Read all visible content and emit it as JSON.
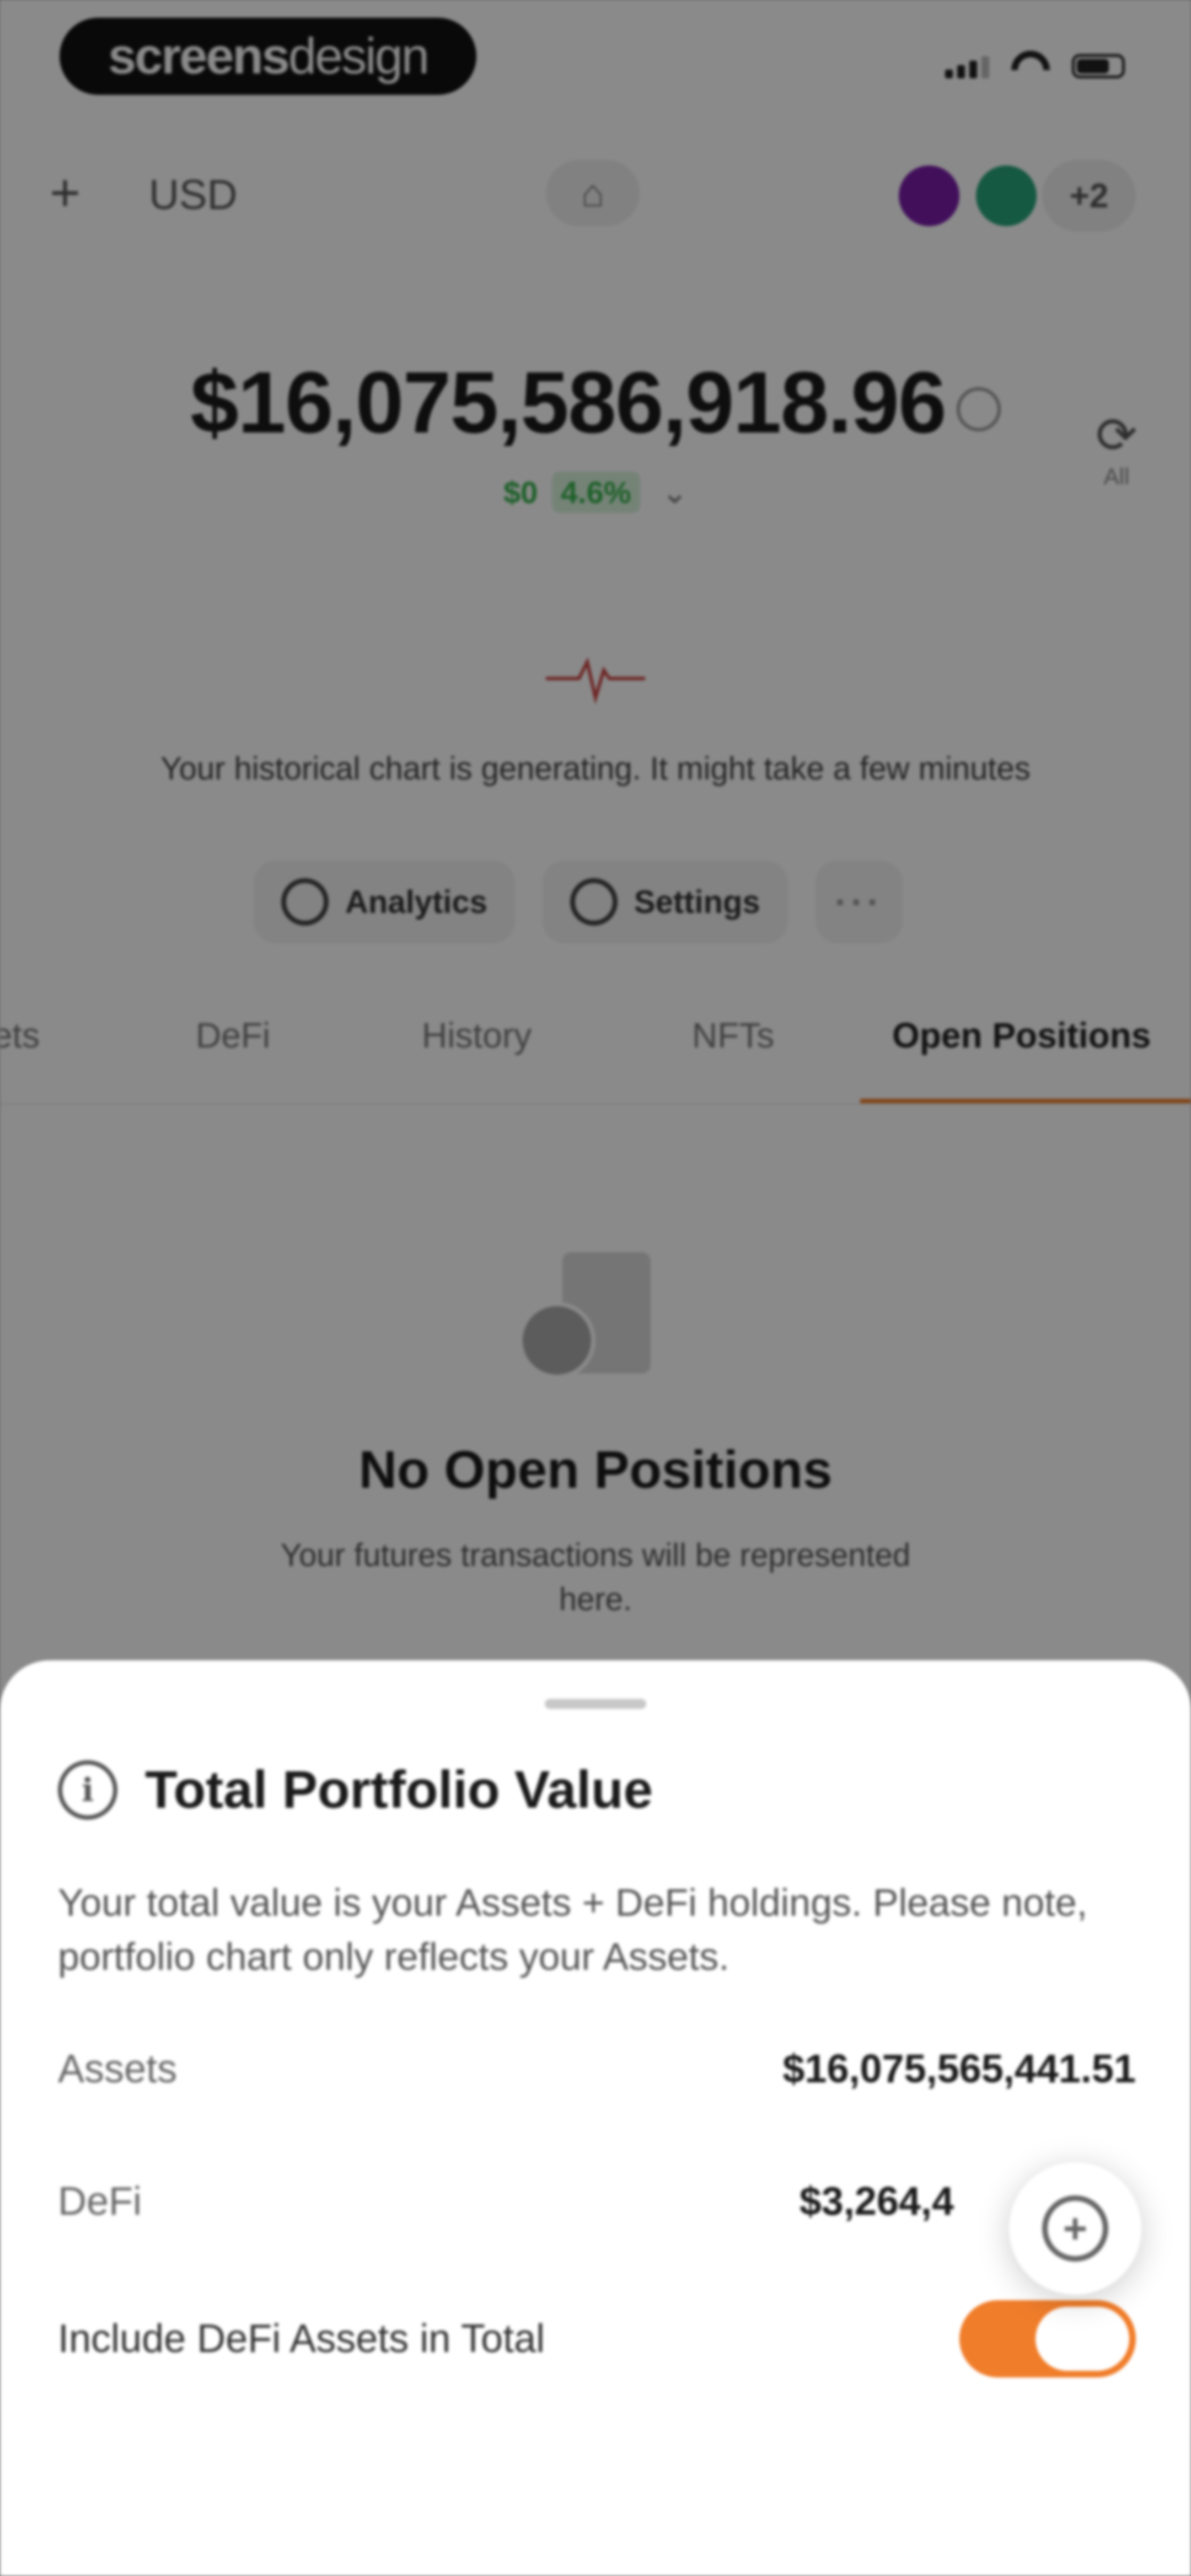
{
  "watermark": {
    "part1": "screens",
    "part2": "design"
  },
  "header": {
    "plus_icon": "plus-icon",
    "currency": "USD",
    "center_icon": "wallet-icon",
    "extra_accounts": "+2"
  },
  "portfolio": {
    "total": "$16,075,586,918.96",
    "change_amount": "$0",
    "change_pct": "4.6%",
    "refresh_label": "All"
  },
  "chart": {
    "status_text": "Your historical chart is generating. It might take a few minutes"
  },
  "actions": {
    "analytics": "Analytics",
    "settings": "Settings",
    "more": "···"
  },
  "tabs": [
    {
      "label": "Assets"
    },
    {
      "label": "DeFi"
    },
    {
      "label": "History"
    },
    {
      "label": "NFTs"
    },
    {
      "label": "Open Positions",
      "active": true
    }
  ],
  "empty_state": {
    "title": "No Open Positions",
    "subtitle": "Your futures transactions will be represented here."
  },
  "sheet": {
    "title": "Total Portfolio Value",
    "description": "Your total value is your Assets + DeFi holdings. Please note, portfolio chart only reflects your Assets.",
    "rows": [
      {
        "label": "Assets",
        "value": "$16,075,565,441.51"
      },
      {
        "label": "DeFi",
        "value": "$3,264,4"
      }
    ],
    "toggle_label": "Include DeFi Assets in Total",
    "toggle_on": true
  },
  "colors": {
    "accent": "#f07d2a",
    "positive": "#37b24d"
  }
}
